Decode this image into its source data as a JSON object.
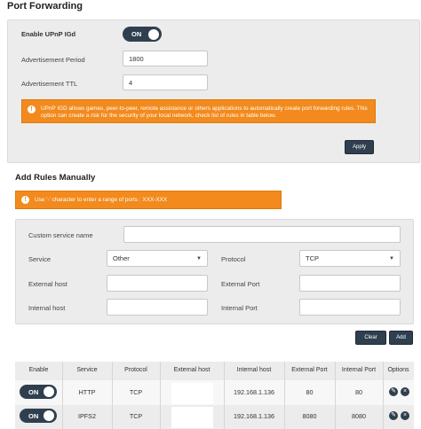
{
  "upnp": {
    "title": "Port Forwarding",
    "enable_label": "Enable UPnP IGd",
    "enable_state": "ON",
    "adv_period_label": "Advertisement Period",
    "adv_period_value": "1800",
    "adv_ttl_label": "Advertisement TTL",
    "adv_ttl_value": "4",
    "info_text": "UPnP IGD allows games, peer-to-peer, remote assistance or others applications to automatically create port forwarding rules. This option can create a risk for the security of your local network, check list of rules in table below.",
    "apply_label": "Apply"
  },
  "add_rules": {
    "title": "Add Rules Manually",
    "hint_text": "Use '-' character to enter a range of ports : XXX-XXX",
    "service_name_label": "Custom service name",
    "service_name_value": "",
    "service_label": "Service",
    "service_value": "Other",
    "protocol_label": "Protocol",
    "protocol_value": "TCP",
    "ext_host_label": "External host",
    "ext_host_value": "",
    "ext_port_label": "External Port",
    "ext_port_value": "",
    "int_host_label": "Internal host",
    "int_host_value": "",
    "int_port_label": "Internal Port",
    "int_port_value": "",
    "clear_label": "Clear",
    "add_label": "Add"
  },
  "table": {
    "headers": [
      "Enable",
      "Service",
      "Protocol",
      "External host",
      "Internal host",
      "External Port",
      "Internal Port",
      "Options"
    ],
    "rows": [
      {
        "enable": "ON",
        "service": "HTTP",
        "protocol": "TCP",
        "ext_host": "",
        "int_host": "192.168.1.136",
        "ext_port": "80",
        "int_port": "80"
      },
      {
        "enable": "ON",
        "service": "IPFS2",
        "protocol": "TCP",
        "ext_host": "",
        "int_host": "192.168.1.136",
        "ext_port": "8080",
        "int_port": "8080"
      }
    ]
  },
  "colors": {
    "accent_dark": "#2f3f4f",
    "warning_orange": "#f28a1d",
    "panel_bg": "#ececec"
  },
  "icons": {
    "info": "info-icon",
    "edit": "pencil-icon",
    "delete": "close-icon",
    "dropdown": "chevron-down-icon"
  }
}
